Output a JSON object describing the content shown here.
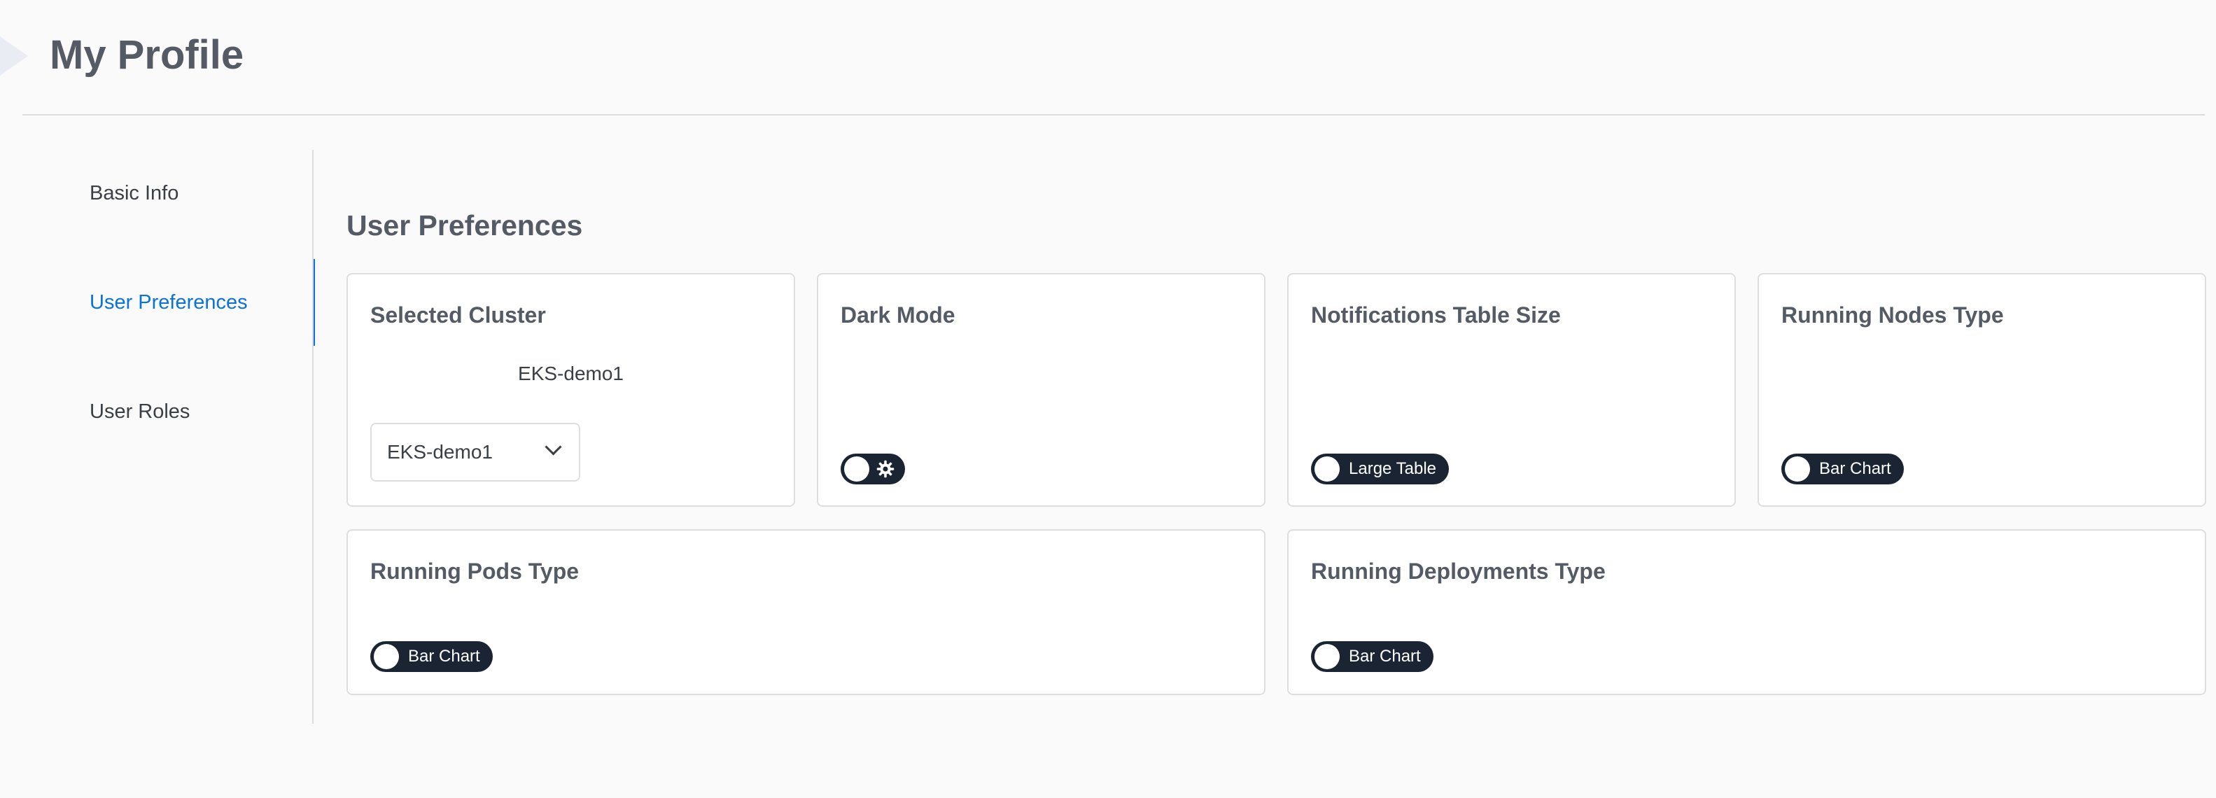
{
  "header": {
    "title": "My Profile"
  },
  "sidebar": {
    "items": [
      {
        "label": "Basic Info",
        "active": false
      },
      {
        "label": "User Preferences",
        "active": true
      },
      {
        "label": "User Roles",
        "active": false
      }
    ]
  },
  "main": {
    "section_title": "User Preferences",
    "cards": {
      "selected_cluster": {
        "title": "Selected Cluster",
        "current_cluster": "EKS-demo1",
        "select_value": "EKS-demo1"
      },
      "dark_mode": {
        "title": "Dark Mode",
        "toggle_icon": "gear-icon"
      },
      "notifications_table_size": {
        "title": "Notifications Table Size",
        "toggle_label": "Large Table"
      },
      "running_nodes_type": {
        "title": "Running Nodes Type",
        "toggle_label": "Bar Chart"
      },
      "running_pods_type": {
        "title": "Running Pods Type",
        "toggle_label": "Bar Chart"
      },
      "running_deployments_type": {
        "title": "Running Deployments Type",
        "toggle_label": "Bar Chart"
      }
    }
  },
  "colors": {
    "accent": "#0a73d9",
    "toggle_bg": "#1a2433",
    "page_bg": "#fafafa"
  }
}
